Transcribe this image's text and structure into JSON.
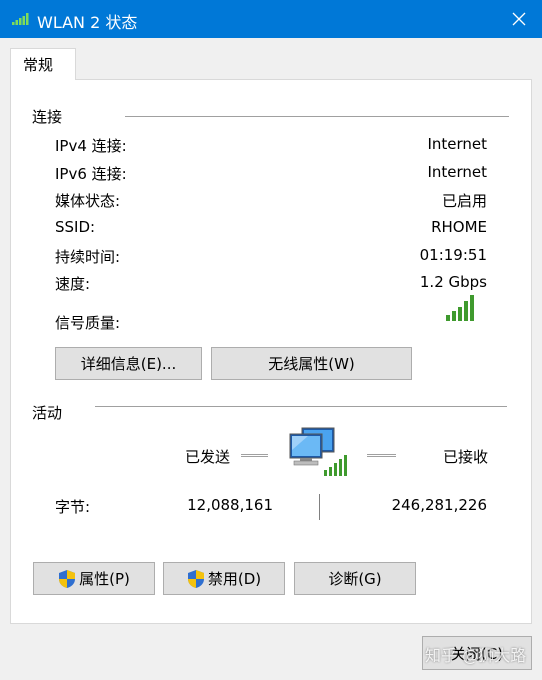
{
  "window": {
    "title": "WLAN 2 状态",
    "title_icon": "wifi-signal-icon",
    "accent_color": "#0078d7"
  },
  "tab": {
    "label": "常规"
  },
  "connection": {
    "section_title": "连接",
    "rows": [
      {
        "label": "IPv4 连接:",
        "value": "Internet"
      },
      {
        "label": "IPv6 连接:",
        "value": "Internet"
      },
      {
        "label": "媒体状态:",
        "value": "已启用"
      },
      {
        "label": "SSID:",
        "value": "RHOME"
      },
      {
        "label": "持续时间:",
        "value": "01:19:51"
      },
      {
        "label": "速度:",
        "value": "1.2 Gbps"
      }
    ],
    "signal_label": "信号质量:",
    "signal_bars": 5,
    "details_button": "详细信息(E)...",
    "wireless_props_button": "无线属性(W)"
  },
  "activity": {
    "section_title": "活动",
    "sent_label": "已发送",
    "received_label": "已接收",
    "bytes_label": "字节:",
    "bytes_sent": "12,088,161",
    "bytes_received": "246,281,226"
  },
  "actions": {
    "properties_button": "属性(P)",
    "disable_button": "禁用(D)",
    "diagnose_button": "诊断(G)"
  },
  "footer": {
    "close_button": "关闭(C)",
    "watermark": "知乎 @狮大路"
  }
}
